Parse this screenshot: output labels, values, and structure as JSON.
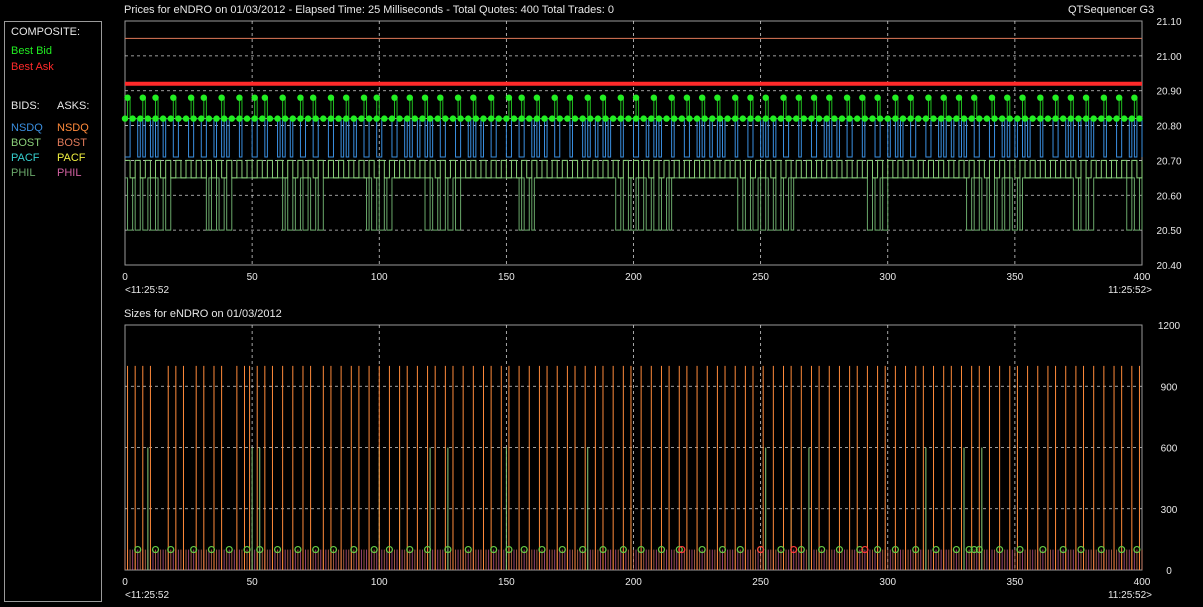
{
  "header": {
    "prices_title": "Prices for  eNDRO  on  01/03/2012  -  Elapsed Time: 25 Milliseconds  -  Total Quotes: 400  Total Trades: 0",
    "app_name": "QTSequencer G3",
    "sizes_title": "Sizes for  eNDRO  on  01/03/2012"
  },
  "legend": {
    "composite_label": "COMPOSITE:",
    "best_bid": "Best Bid",
    "best_ask": "Best Ask",
    "bids_label": "BIDS:",
    "asks_label": "ASKS:",
    "bids": [
      "NSDQ",
      "BOST",
      "PACF",
      "PHIL"
    ],
    "asks": [
      "NSDQ",
      "BOST",
      "PACF",
      "PHIL"
    ]
  },
  "colors": {
    "best_bid": "#22ee22",
    "best_ask": "#ff2a2a",
    "bid_nsdq": "#3a8fe0",
    "bid_bost": "#8ad07a",
    "bid_pacf": "#36d0d0",
    "bid_phil": "#6aa86a",
    "ask_nsdq": "#ff8a3a",
    "ask_bost": "#e07a5a",
    "ask_pacf": "#f0f040",
    "ask_phil": "#d060a0",
    "grid": "#cfcfcf"
  },
  "chart_data": [
    {
      "type": "line",
      "name": "prices",
      "xlim": [
        0,
        400
      ],
      "ylim": [
        20.4,
        21.1
      ],
      "x_ticks": [
        0,
        50,
        100,
        150,
        200,
        250,
        300,
        350,
        400
      ],
      "y_ticks": [
        "21.10",
        "21.00",
        "20.90",
        "20.80",
        "20.70",
        "20.60",
        "20.50",
        "20.40"
      ],
      "x_start_label": "<11:25:52",
      "x_end_label": "11:25:52>",
      "reference_lines": [
        21.05,
        20.92,
        20.82
      ],
      "best_ask": 20.92,
      "best_bid_levels": [
        20.82,
        20.88
      ],
      "bid_nsdq_levels": [
        20.71,
        20.82
      ],
      "bid_bost_levels": [
        20.65,
        20.7
      ],
      "bid_phil_levels": [
        20.5,
        20.65
      ],
      "best_bid_high_x": [
        1,
        7,
        12,
        19,
        26,
        31,
        38,
        45,
        51,
        55,
        62,
        69,
        74,
        81,
        87,
        94,
        99,
        106,
        112,
        118,
        124,
        131,
        137,
        144,
        151,
        156,
        162,
        169,
        175,
        182,
        188,
        195,
        201,
        208,
        215,
        221,
        227,
        233,
        240,
        246,
        252,
        259,
        265,
        271,
        277,
        284,
        290,
        296,
        303,
        309,
        316,
        322,
        328,
        334,
        341,
        347,
        353,
        360,
        366,
        372,
        378,
        385,
        391,
        397
      ],
      "phil_low_x": [
        [
          0,
          17
        ],
        [
          32,
          42
        ],
        [
          62,
          78
        ],
        [
          95,
          104
        ],
        [
          118,
          131
        ],
        [
          155,
          160
        ],
        [
          193,
          214
        ],
        [
          240,
          262
        ],
        [
          292,
          300
        ],
        [
          330,
          352
        ],
        [
          372,
          380
        ],
        [
          394,
          400
        ]
      ]
    },
    {
      "type": "bar",
      "name": "sizes",
      "xlim": [
        0,
        400
      ],
      "ylim": [
        0,
        1200
      ],
      "x_ticks": [
        0,
        50,
        100,
        150,
        200,
        250,
        300,
        350,
        400
      ],
      "y_ticks": [
        1200,
        900,
        600,
        300,
        0
      ],
      "x_start_label": "<11:25:52",
      "x_end_label": "11:25:52>",
      "tall_size": 1000,
      "mid_size": 600,
      "base_size": 100,
      "tall_x": [
        1,
        4,
        7,
        10,
        17,
        20,
        23,
        28,
        31,
        35,
        38,
        44,
        47,
        49,
        52,
        55,
        58,
        62,
        66,
        70,
        73,
        78,
        81,
        85,
        89,
        92,
        96,
        100,
        104,
        108,
        111,
        115,
        119,
        122,
        126,
        129,
        133,
        137,
        141,
        144,
        148,
        151,
        155,
        159,
        163,
        166,
        170,
        174,
        177,
        181,
        185,
        188,
        192,
        196,
        199,
        203,
        207,
        211,
        214,
        218,
        221,
        225,
        229,
        233,
        236,
        240,
        244,
        247,
        251,
        255,
        259,
        262,
        266,
        270,
        273,
        277,
        281,
        285,
        288,
        292,
        296,
        299,
        303,
        307,
        311,
        314,
        318,
        322,
        325,
        329,
        333,
        336,
        340,
        344,
        348,
        351,
        355,
        359,
        363,
        366,
        370,
        374,
        377,
        381,
        385,
        389,
        392,
        396,
        399
      ],
      "mid_x": [
        9,
        50,
        53,
        100,
        108,
        120,
        127,
        150,
        182,
        199,
        252,
        262,
        269,
        315,
        330,
        337
      ],
      "marker_x": [
        5,
        12,
        18,
        27,
        34,
        41,
        48,
        53,
        60,
        68,
        75,
        82,
        90,
        98,
        104,
        112,
        119,
        127,
        135,
        145,
        151,
        157,
        164,
        172,
        180,
        188,
        196,
        203,
        211,
        218,
        227,
        235,
        242,
        250,
        258,
        266,
        274,
        281,
        289,
        296,
        303,
        311,
        319,
        327,
        332,
        334,
        336,
        344,
        352,
        361,
        369,
        376,
        384,
        392,
        398
      ],
      "red_marker_x": [
        219,
        250,
        263,
        291
      ]
    }
  ]
}
